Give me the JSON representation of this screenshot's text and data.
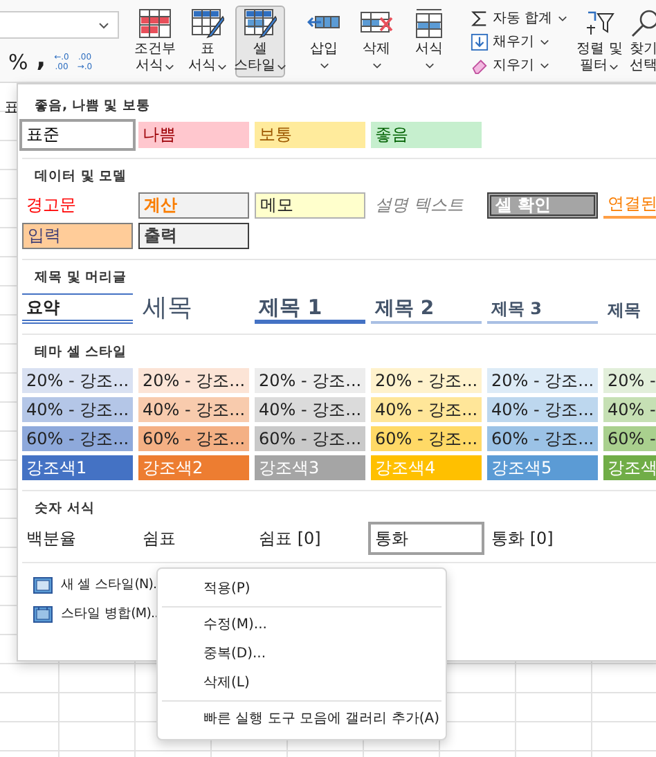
{
  "ribbon": {
    "number_buttons": [
      {
        "kind": "text",
        "label": "%"
      },
      {
        "kind": "text",
        "label": ","
      },
      {
        "kind": "decimal",
        "top": "←.0",
        "bottom": ".00"
      },
      {
        "kind": "decimal",
        "top": ".00",
        "bottom": "→.0"
      }
    ],
    "style_buttons": [
      {
        "lines": [
          "조건부",
          "서식"
        ],
        "dropdown": true,
        "selected": false
      },
      {
        "lines": [
          "표",
          "서식"
        ],
        "dropdown": true,
        "selected": false
      },
      {
        "lines": [
          "셀",
          "스타일"
        ],
        "dropdown": true,
        "selected": true
      }
    ],
    "cell_buttons": [
      {
        "lines": [
          "삽입"
        ],
        "dropdown": true,
        "selected": false
      },
      {
        "lines": [
          "삭제"
        ],
        "dropdown": true,
        "selected": false
      },
      {
        "lines": [
          "서식"
        ],
        "dropdown": true,
        "selected": false
      }
    ],
    "editing_buttons": [
      {
        "label": "자동 합계",
        "dropdown": true
      },
      {
        "label": "채우기",
        "dropdown": true
      },
      {
        "label": "지우기",
        "dropdown": true
      }
    ],
    "sort_buttons": [
      {
        "lines": [
          "정렬 및",
          "필터"
        ],
        "dropdown": true,
        "selected": false
      },
      {
        "lines": [
          "찾기",
          "선택"
        ],
        "dropdown": false,
        "selected": false
      }
    ]
  },
  "sheet": {
    "cell_text": "표"
  },
  "gallery": {
    "sections": [
      {
        "title": "좋음, 나쁨 및 보통",
        "rows": [
          [
            {
              "label": "표준",
              "kind": "normal",
              "selected": true
            },
            {
              "label": "나쁨",
              "kind": "bad",
              "selected": false
            },
            {
              "label": "보통",
              "kind": "neutral",
              "selected": false
            },
            {
              "label": "좋음",
              "kind": "good",
              "selected": false
            }
          ]
        ]
      },
      {
        "title": "데이터 및 모델",
        "rows": [
          [
            {
              "label": "경고문",
              "kind": "warning",
              "selected": false
            },
            {
              "label": "계산",
              "kind": "calculation",
              "selected": false
            },
            {
              "label": "메모",
              "kind": "note",
              "selected": false
            },
            {
              "label": "설명 텍스트",
              "kind": "explanatory",
              "selected": false
            },
            {
              "label": "셀 확인",
              "kind": "check",
              "selected": false
            },
            {
              "label": "연결된",
              "kind": "linked",
              "selected": false
            }
          ],
          [
            {
              "label": "입력",
              "kind": "input",
              "selected": false
            },
            {
              "label": "출력",
              "kind": "output",
              "selected": false
            }
          ]
        ]
      },
      {
        "title": "제목 및 머리글",
        "rows": [
          [
            {
              "label": "요약",
              "kind": "total",
              "selected": false
            },
            {
              "label": "세목",
              "kind": "title",
              "selected": false
            },
            {
              "label": "제목 1",
              "kind": "heading1",
              "selected": false
            },
            {
              "label": "제목 2",
              "kind": "heading2",
              "selected": false
            },
            {
              "label": "제목 3",
              "kind": "heading3",
              "selected": false
            },
            {
              "label": "제목",
              "kind": "heading4",
              "selected": false
            }
          ]
        ]
      },
      {
        "title": "테마 셀 스타일",
        "rows": [
          [
            {
              "label": "20% - 강조...",
              "kind": "tint",
              "color": "#d9e1f2",
              "selected": false
            },
            {
              "label": "20% - 강조...",
              "kind": "tint",
              "color": "#fce4d6",
              "selected": false
            },
            {
              "label": "20% - 강조...",
              "kind": "tint",
              "color": "#ededed",
              "selected": false
            },
            {
              "label": "20% - 강조...",
              "kind": "tint",
              "color": "#fff2cc",
              "selected": false
            },
            {
              "label": "20% - 강조...",
              "kind": "tint",
              "color": "#ddebf7",
              "selected": false
            },
            {
              "label": "20% -",
              "kind": "tint",
              "color": "#e2efda",
              "selected": false
            }
          ],
          [
            {
              "label": "40% - 강조...",
              "kind": "tint",
              "color": "#b4c6e7",
              "selected": false
            },
            {
              "label": "40% - 강조...",
              "kind": "tint",
              "color": "#f8cbad",
              "selected": false
            },
            {
              "label": "40% - 강조...",
              "kind": "tint",
              "color": "#dbdbdb",
              "selected": false
            },
            {
              "label": "40% - 강조...",
              "kind": "tint",
              "color": "#ffe699",
              "selected": false
            },
            {
              "label": "40% - 강조...",
              "kind": "tint",
              "color": "#bdd7ee",
              "selected": false
            },
            {
              "label": "40% -",
              "kind": "tint",
              "color": "#c6e0b4",
              "selected": false
            }
          ],
          [
            {
              "label": "60% - 강조...",
              "kind": "tint",
              "color": "#8ea9db",
              "selected": false
            },
            {
              "label": "60% - 강조...",
              "kind": "tint",
              "color": "#f4b084",
              "selected": false
            },
            {
              "label": "60% - 강조...",
              "kind": "tint",
              "color": "#c9c9c9",
              "selected": false
            },
            {
              "label": "60% - 강조...",
              "kind": "tint",
              "color": "#ffd966",
              "selected": false
            },
            {
              "label": "60% - 강조...",
              "kind": "tint",
              "color": "#9bc2e6",
              "selected": false
            },
            {
              "label": "60% -",
              "kind": "tint",
              "color": "#a9d08e",
              "selected": false
            }
          ],
          [
            {
              "label": "강조색1",
              "kind": "accent",
              "color": "#4472c4",
              "selected": false
            },
            {
              "label": "강조색2",
              "kind": "accent",
              "color": "#ed7d31",
              "selected": false
            },
            {
              "label": "강조색3",
              "kind": "accent",
              "color": "#a5a5a5",
              "selected": false
            },
            {
              "label": "강조색4",
              "kind": "accent",
              "color": "#ffc000",
              "selected": false
            },
            {
              "label": "강조색5",
              "kind": "accent",
              "color": "#5b9bd5",
              "selected": false
            },
            {
              "label": "강조색",
              "kind": "accent",
              "color": "#70ad47",
              "selected": false
            }
          ]
        ]
      },
      {
        "title": "숫자 서식",
        "rows": [
          [
            {
              "label": "백분율",
              "kind": "number",
              "selected": false
            },
            {
              "label": "쉼표",
              "kind": "number",
              "selected": false
            },
            {
              "label": "쉼표 [0]",
              "kind": "number",
              "selected": false
            },
            {
              "label": "통화",
              "kind": "number",
              "selected": true
            },
            {
              "label": "통화 [0]",
              "kind": "number",
              "selected": false
            }
          ]
        ]
      }
    ],
    "actions": [
      {
        "label": "새 셀 스타일(N)."
      },
      {
        "label": "스타일 병합(M).."
      }
    ]
  },
  "context_menu": {
    "items": [
      {
        "kind": "item",
        "label": "적용(P)"
      },
      {
        "kind": "separator"
      },
      {
        "kind": "item",
        "label": "수정(M)..."
      },
      {
        "kind": "item",
        "label": "중복(D)..."
      },
      {
        "kind": "item",
        "label": "삭제(L)"
      },
      {
        "kind": "separator"
      },
      {
        "kind": "item",
        "label": "빠른 실행 도구 모음에 갤러리 추가(A)"
      }
    ]
  }
}
